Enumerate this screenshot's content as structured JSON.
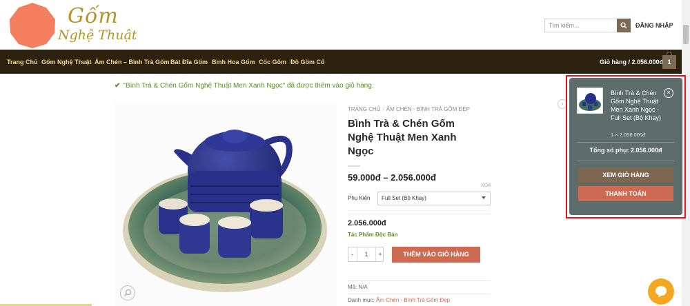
{
  "header": {
    "logo_line1": "Gốm",
    "logo_line2": "Nghệ Thuật",
    "search_placeholder": "Tìm kiếm...",
    "login": "ĐĂNG NHẬP"
  },
  "nav": {
    "items": [
      "Trang Chủ",
      "Gốm Nghệ Thuật",
      "Ấm Chén – Bình Trà Gốm",
      "Bát Đĩa Gốm",
      "Bình Hoa Gốm",
      "Cốc Gốm",
      "Đồ Gốm Cổ"
    ],
    "cart_label": "Giỏ hàng / 2.056.000đ",
    "cart_count": "1"
  },
  "notice": {
    "check": "✔",
    "text": "\"Bình Trà & Chén Gốm Nghệ Thuật Men Xanh Ngọc\" đã được thêm vào giỏ hàng."
  },
  "product": {
    "breadcrumb_home": "TRANG CHỦ",
    "breadcrumb_sep": "/",
    "breadcrumb_cat": "ẤM CHÉN - BÌNH TRÀ GỐM ĐẸP",
    "title": "Bình Trà & Chén Gốm Nghệ Thuật Men Xanh Ngọc",
    "price_range": "59.000đ – 2.056.000đ",
    "clear": "XÓA",
    "option_label": "Phụ Kiện",
    "option_value": "Full Set (Bộ Khay)",
    "variation_price": "2.056.000đ",
    "stock": "Tác Phẩm Độc Bản",
    "qty_minus": "-",
    "qty_value": "1",
    "qty_plus": "+",
    "add_to_cart": "THÊM VÀO GIỎ HÀNG",
    "sku_label": "Mã: N/A",
    "category_label": "Danh mục:",
    "category_link": "Ấm Chén - Bình Trà Gốm Đẹp",
    "next": "›"
  },
  "minicart": {
    "item_name": "Bình Trà & Chén Gốm Nghệ Thuật Men Xanh Ngọc - Full Set (Bộ Khay)",
    "remove": "×",
    "item_qty": "1 × 2.056.000đ",
    "subtotal": "Tổng số phụ: 2.056.000đ",
    "view_cart": "XEM GIỎ HÀNG",
    "checkout": "THANH TOÁN"
  },
  "colors": {
    "nav_bg": "#2d2110",
    "accent": "#cd6b52",
    "brand_brown": "#7d6750",
    "minicart_bg": "#5d6d6c",
    "highlight": "#e2111e"
  }
}
